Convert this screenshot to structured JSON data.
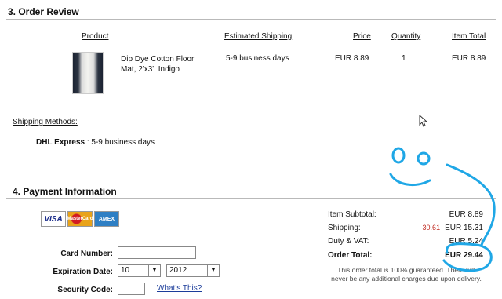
{
  "order_review": {
    "title": "3. Order Review",
    "columns": {
      "product": "Product",
      "shipping": "Estimated Shipping",
      "price": "Price",
      "quantity": "Quantity",
      "total": "Item Total"
    },
    "item": {
      "name_line1": "Dip Dye Cotton Floor",
      "name_line2": "Mat, 2'x3', Indigo",
      "shipping": "5-9 business days",
      "price": "EUR 8.89",
      "quantity": "1",
      "total": "EUR 8.89"
    },
    "shipping_methods_label": "Shipping Methods:",
    "shipping_method": {
      "carrier": "DHL Express",
      "detail": " : 5-9 business days"
    }
  },
  "payment": {
    "title": "4. Payment Information",
    "cards": [
      "VISA",
      "MasterCard",
      "AMEX"
    ],
    "card_number_label": "Card Number:",
    "card_number_value": "",
    "expiration_label": "Expiration Date:",
    "exp_month": "10",
    "exp_year": "2012",
    "security_label": "Security Code:",
    "whats_this": "What's This?"
  },
  "summary": {
    "subtotal_label": "Item Subtotal:",
    "subtotal_value": "EUR 8.89",
    "shipping_label": "Shipping:",
    "shipping_old": "30.61",
    "shipping_value": "EUR 15.31",
    "duty_label": "Duty & VAT:",
    "duty_value": "EUR 5.24",
    "total_label": "Order Total:",
    "total_value": "EUR 29.44",
    "note_line1": "This order total is 100% guaranteed. There will",
    "note_line2": "never be any additional charges due upon delivery."
  },
  "colors": {
    "annotation": "#1fa7e6",
    "strike": "#c0281e"
  },
  "icons": {
    "cursor": "mouse-pointer-icon"
  }
}
